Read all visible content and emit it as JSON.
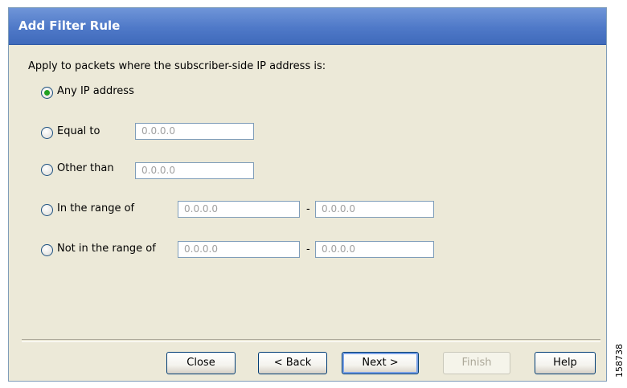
{
  "dialog": {
    "title": "Add Filter Rule",
    "prompt": "Apply to packets where the subscriber-side IP address is:"
  },
  "options": [
    {
      "label": "Any IP address",
      "selected": true
    },
    {
      "label": "Equal to",
      "selected": false,
      "value": "0.0.0.0"
    },
    {
      "label": "Other than",
      "selected": false,
      "value": "0.0.0.0"
    },
    {
      "label": "In the range of",
      "selected": false,
      "from": "0.0.0.0",
      "separator": "-",
      "to": "0.0.0.0"
    },
    {
      "label": "Not in the range of",
      "selected": false,
      "from": "0.0.0.0",
      "separator": "-",
      "to": "0.0.0.0"
    }
  ],
  "buttons": {
    "close": "Close",
    "back": "< Back",
    "next": "Next >",
    "finish": "Finish",
    "help": "Help"
  },
  "figure_number": "158738",
  "colors": {
    "titlebar": "#4f79c8",
    "dialog_bg": "#ece9d8",
    "radio_dot": "#21a121"
  }
}
